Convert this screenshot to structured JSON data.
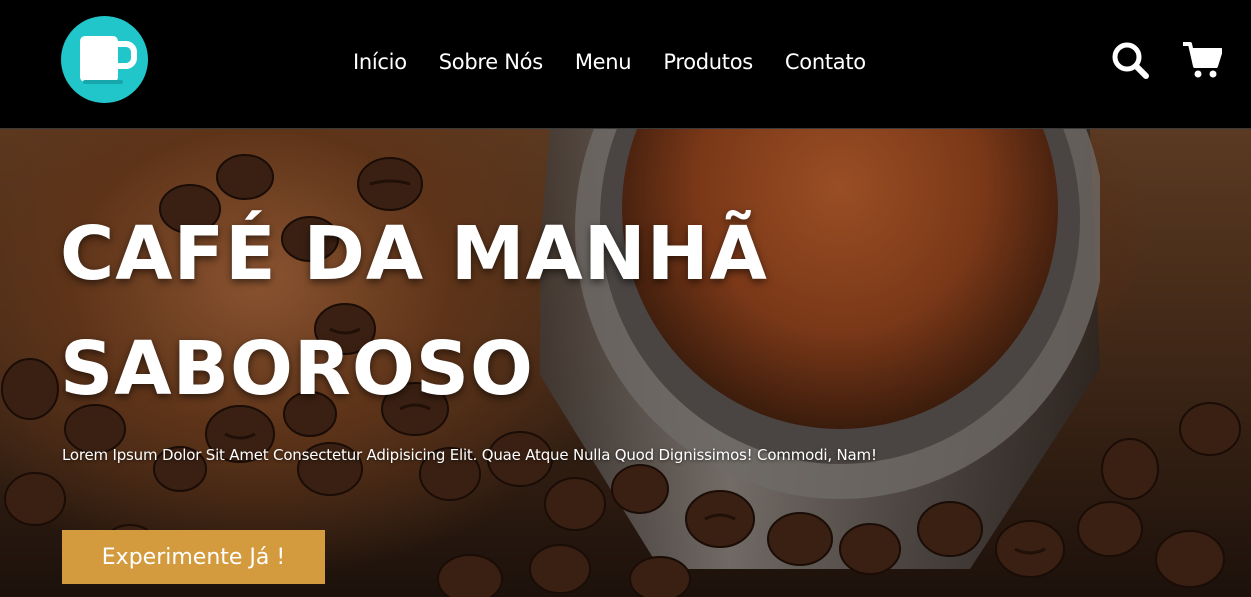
{
  "header": {
    "logo_icon": "coffee-mug-icon",
    "logo_color": "#21c6cb",
    "nav": [
      {
        "label": "Início"
      },
      {
        "label": "Sobre Nós"
      },
      {
        "label": "Menu"
      },
      {
        "label": "Produtos"
      },
      {
        "label": "Contato"
      }
    ],
    "search_icon": "search-icon",
    "cart_icon": "cart-icon"
  },
  "hero": {
    "title_line1": "CAFÉ DA MANHÃ",
    "title_line2": "SABOROSO",
    "description": "Lorem Ipsum Dolor Sit Amet Consectetur Adipisicing Elit. Quae Atque Nulla Quod Dignissimos! Commodi, Nam!",
    "cta_label": "Experimente Já !",
    "cta_color": "#d39a3e"
  }
}
